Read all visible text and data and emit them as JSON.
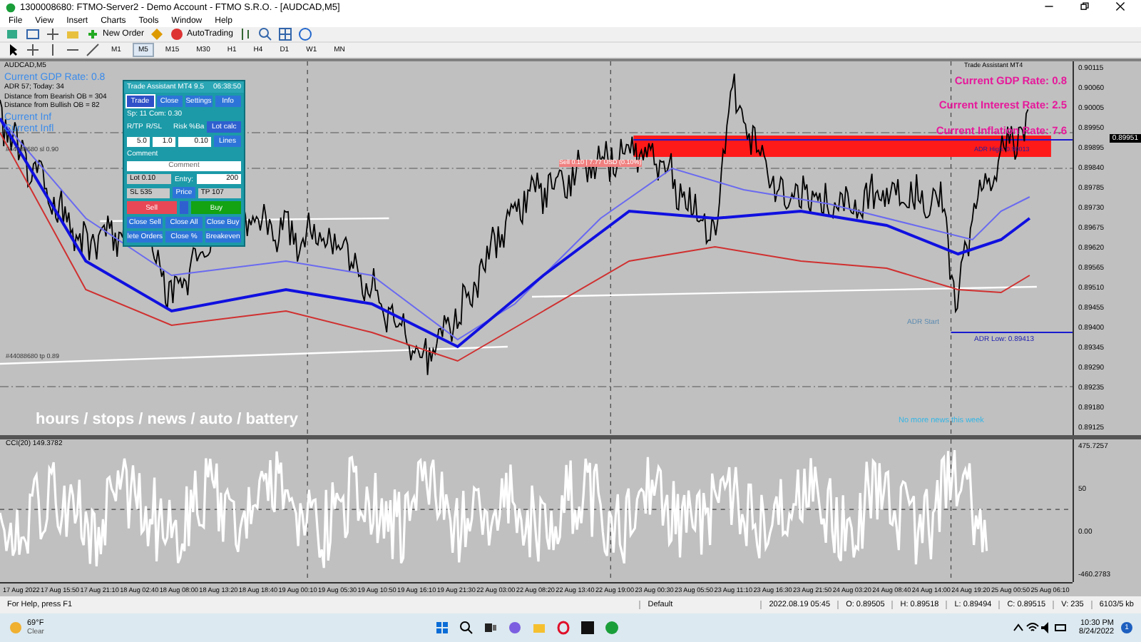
{
  "window": {
    "title": "1300008680: FTMO-Server2 - Demo Account - FTMO S.R.O. - [AUDCAD,M5]"
  },
  "menu": [
    "File",
    "View",
    "Insert",
    "Charts",
    "Tools",
    "Window",
    "Help"
  ],
  "toolbar": {
    "new_order": "New Order",
    "auto_trading": "AutoTrading"
  },
  "timeframes": [
    {
      "label": "M1",
      "selected": false
    },
    {
      "label": "M5",
      "selected": true
    },
    {
      "label": "M15",
      "selected": false
    },
    {
      "label": "M30",
      "selected": false
    },
    {
      "label": "H1",
      "selected": false
    },
    {
      "label": "H4",
      "selected": false
    },
    {
      "label": "D1",
      "selected": false
    },
    {
      "label": "W1",
      "selected": false
    },
    {
      "label": "MN",
      "selected": false
    }
  ],
  "chart": {
    "symbol": "AUDCAD,M5",
    "info_lines": [
      "ADR 57; Today: 34",
      "Distance from Bearish OB = 304",
      "Distance from Bullish OB = 82"
    ],
    "left_rates": [
      "Current GDP Rate: 0.8",
      "Current Inf",
      "Current Infl"
    ],
    "order_labels": [
      "#44088680 sl 0.90",
      "#44088680 tp 0.89"
    ],
    "trade_assistant_tag": "Trade Assistant MT4",
    "rates": [
      "Current GDP Rate: 0.8",
      "Current Interest Rate: 2.5",
      "Current Inflation Rate: 7.6"
    ],
    "sell_label": "Sell 0.10 | 7.77 USD (0.10%)",
    "adr_high": "ADR High: 0.90013",
    "adr_start": "ADR Start",
    "adr_low": "ADR Low: 0.89413",
    "news": "No more news this week",
    "banner": "hours / stops / news / auto / battery",
    "current_price": "0.89951",
    "price_ticks": [
      "0.90115",
      "0.90060",
      "0.90005",
      "0.89950",
      "0.89895",
      "0.89840",
      "0.89785",
      "0.89730",
      "0.89675",
      "0.89620",
      "0.89565",
      "0.89510",
      "0.89455",
      "0.89400",
      "0.89345",
      "0.89290",
      "0.89235",
      "0.89180",
      "0.89125"
    ]
  },
  "oscillator": {
    "label": "CCI(20) 149.3782",
    "ticks": [
      "475.7257",
      "50",
      "0.00",
      "-460.2783"
    ]
  },
  "time_ticks": [
    "17 Aug 2022",
    "17 Aug 15:50",
    "17 Aug 21:10",
    "18 Aug 02:40",
    "18 Aug 08:00",
    "18 Aug 13:20",
    "18 Aug 18:40",
    "19 Aug 00:10",
    "19 Aug 05:30",
    "19 Aug 10:50",
    "19 Aug 16:10",
    "19 Aug 21:30",
    "22 Aug 03:00",
    "22 Aug 08:20",
    "22 Aug 13:40",
    "22 Aug 19:00",
    "23 Aug 00:30",
    "23 Aug 05:50",
    "23 Aug 11:10",
    "23 Aug 16:30",
    "23 Aug 21:50",
    "24 Aug 03:20",
    "24 Aug 08:40",
    "24 Aug 14:00",
    "24 Aug 19:20",
    "25 Aug 00:50",
    "25 Aug 06:10"
  ],
  "trade_panel": {
    "title": "Trade Assistant MT4 9.5",
    "clock": "06:38:50",
    "tabs": [
      {
        "label": "Trade",
        "selected": true
      },
      {
        "label": "Close",
        "selected": false
      },
      {
        "label": "Settings",
        "selected": false
      },
      {
        "label": "Info",
        "selected": false
      }
    ],
    "spread": "Sp: 11  Com: 0.30",
    "rtp_label": "R/TP",
    "rsl_label": "R/SL",
    "risk_label": "Risk %Ba",
    "rtp": "5.0",
    "rsl": "1.0",
    "risk": "0.10",
    "lot_calc": "Lot calc",
    "lines": "Lines",
    "comment_label": "Comment",
    "comment_placeholder": "Comment",
    "lot_label": "Lot",
    "lots": "0.10",
    "entry_label": "Entry:",
    "entry": "200",
    "sl_label": "SL",
    "sl": "535",
    "price": "Price",
    "tp_label": "TP",
    "tp": "107",
    "sell": "Sell",
    "buy": "Buy",
    "close_buttons": [
      "Close Sell",
      "Close All",
      "Close Buy",
      "lete Orders",
      "Close %",
      "Breakeven"
    ]
  },
  "status_bar": {
    "help": "For Help, press F1",
    "profile": "Default",
    "time": "2022.08.19 05:45",
    "open": "O: 0.89505",
    "high": "H: 0.89518",
    "low": "L: 0.89494",
    "close": "C: 0.89515",
    "volume": "V: 235",
    "traffic": "6103/5 kb"
  },
  "taskbar": {
    "temperature": "69°F",
    "weather": "Clear",
    "clock": "10:30 PM",
    "date": "8/24/2022",
    "notifications": "1"
  }
}
